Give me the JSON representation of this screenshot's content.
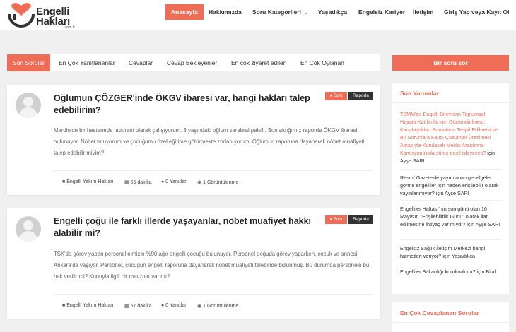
{
  "logo": {
    "line1": "Engelli",
    "line2": "Hakları",
    "sub": "com.tr"
  },
  "nav": {
    "items": [
      {
        "label": "Anasayfa",
        "active": true
      },
      {
        "label": "Hakkımızda"
      },
      {
        "label": "Soru Kategorileri",
        "dropdown": true
      },
      {
        "label": "Yaşadıkça"
      },
      {
        "label": "Engelsiz Kariyer"
      },
      {
        "label": "İletişim"
      },
      {
        "label": "Giriş Yap veya Kayıt Ol"
      }
    ]
  },
  "tabs": [
    "Son Sorular",
    "En Çok Yanıtlananlar",
    "Cevaplar",
    "Cevap Bekleyenler",
    "En çok ziyaret edilen",
    "En Çok Oylanan"
  ],
  "questions": [
    {
      "title": "Oğlumun ÇÖZGER'inde ÖKGV ibaresi var, hangi hakları talep edebilirim?",
      "soru_label": "Soru",
      "rapor_label": "Raporla",
      "body": "Mardin'de bir hastanede laborant olarak çalışıyorum. 3 yaşındaki oğlum serebral palsili. Son aldığımız raporda ÖKGV ibaresi bulunuyor. Nöbet tutuyorum ve çocuğumu özel eğitime götürmekte zorlanıyorum. Oğlumun raporuna dayanarak nöbet muafiyeti talep edebilir miyim?",
      "category": "Engelli Yakını Hakları",
      "time": "55 dakika",
      "answers": "0 Yanıtlar",
      "views": "1 Görüntülenme"
    },
    {
      "title": "Engelli çoğu ile farklı illerde yaşayanlar, nöbet muafiyet hakkı alabilir mi?",
      "soru_label": "Soru",
      "rapor_label": "Raporla",
      "body": "TSK'da görev yapan personelinimizin %90 ağır engelli çocuğu bulunuyor. Personel doğuda görev yaparken, çocuk ve annesi Ankara'da yaşıyor. Personel, çocuğun engelli raporuna dayanarak nöbet muafiyeti talebinde bulunmuş. Bu durumda personele bu hak verilir mi? Konuyla ilgili bir mevzuat var mı?",
      "category": "Engelli Yakını Hakları",
      "time": "57 dakika",
      "answers": "0 Yanıtlar",
      "views": "1 Görüntülenme"
    }
  ],
  "sidebar": {
    "ask_button": "Bir soru sor",
    "recent_title": "Son Yorumlar",
    "comments": [
      {
        "link": "TBMM'de Engelli Bireylerin Toplumsal Hayata Katılımlarının Güçlendirilmesi, Karşılaştıkları Sorunların Tespit Edilmesi ve Bu Sorunlara Kalıcı Çözümler Üretilmesi Amacıyla Kurulacak Meclis Araştırma Komisyonu'nda süreç nasıl işleyecek?",
        "suffix": "için Ayşe SARI"
      },
      {
        "link": "",
        "text": "Resmî Gazete'de yayımlanan genelgeler görme engelliler için neden erişilebilir olarak yayınlanmıyor?",
        "suffix": "için Ayşe SARI"
      },
      {
        "link": "",
        "text": "Engelliler Haftası'nın son günü olan 16 Mayıs'ın \"Erişilebilirlik Günü\" olarak ilan edilmesine ihtiyaç var mıydı?",
        "suffix": "için Ayşe SARI"
      },
      {
        "link": "",
        "text": "Engelsiz Sağlık İletişim Merkezi hangi hizmetleri veriyor?",
        "suffix": "için Yaşadıkça"
      },
      {
        "link": "",
        "text": "Engelliler Bakanlığı kurulmalı mı?",
        "suffix": "için Bilal"
      }
    ],
    "most_answered_title": "En Çok Cevaplanan Sorular"
  },
  "colors": {
    "accent": "#ef6c57",
    "dark": "#333333"
  },
  "icons": [
    "heart-logo-icon",
    "folder-icon",
    "calendar-icon",
    "comments-icon",
    "eye-icon",
    "info-circle-icon",
    "chevron-down-icon"
  ]
}
